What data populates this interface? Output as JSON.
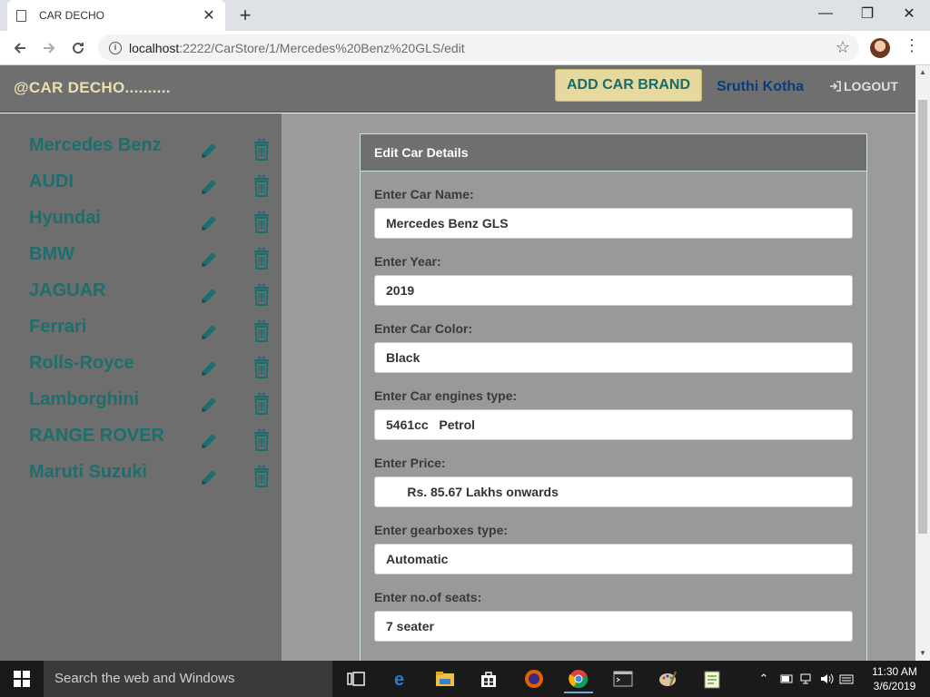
{
  "browser": {
    "tab_title": "CAR DECHO",
    "url_host": "localhost",
    "url_path": ":2222/CarStore/1/Mercedes%20Benz%20GLS/edit"
  },
  "app": {
    "brand": "@CAR DECHO..........",
    "add_brand_label": "ADD CAR BRAND",
    "user_name": "Sruthi Kotha",
    "logout_label": "LOGOUT"
  },
  "sidebar": {
    "brands": [
      "Mercedes Benz",
      "AUDI",
      "Hyundai",
      "BMW",
      "JAGUAR",
      "Ferrari",
      "Rolls-Royce",
      "Lamborghini",
      "RANGE ROVER",
      "Maruti Suzuki"
    ]
  },
  "form": {
    "title": "Edit Car Details",
    "fields": [
      {
        "label": "Enter Car Name:",
        "value": "Mercedes Benz GLS"
      },
      {
        "label": "Enter Year:",
        "value": "2019"
      },
      {
        "label": "Enter Car Color:",
        "value": "Black"
      },
      {
        "label": "Enter Car engines type:",
        "value": "5461cc   Petrol"
      },
      {
        "label": "Enter Price:",
        "value": "      Rs. 85.67 Lakhs onwards"
      },
      {
        "label": "Enter gearboxes type:",
        "value": "Automatic"
      },
      {
        "label": "Enter no.of seats:",
        "value": "7 seater"
      }
    ]
  },
  "taskbar": {
    "search_placeholder": "Search the web and Windows",
    "time": "11:30 AM",
    "date": "3/6/2019"
  },
  "colors": {
    "brand_text": "#1b6f6f",
    "header_bg": "#6f6f6f",
    "add_button_bg": "#e6d9a0"
  }
}
